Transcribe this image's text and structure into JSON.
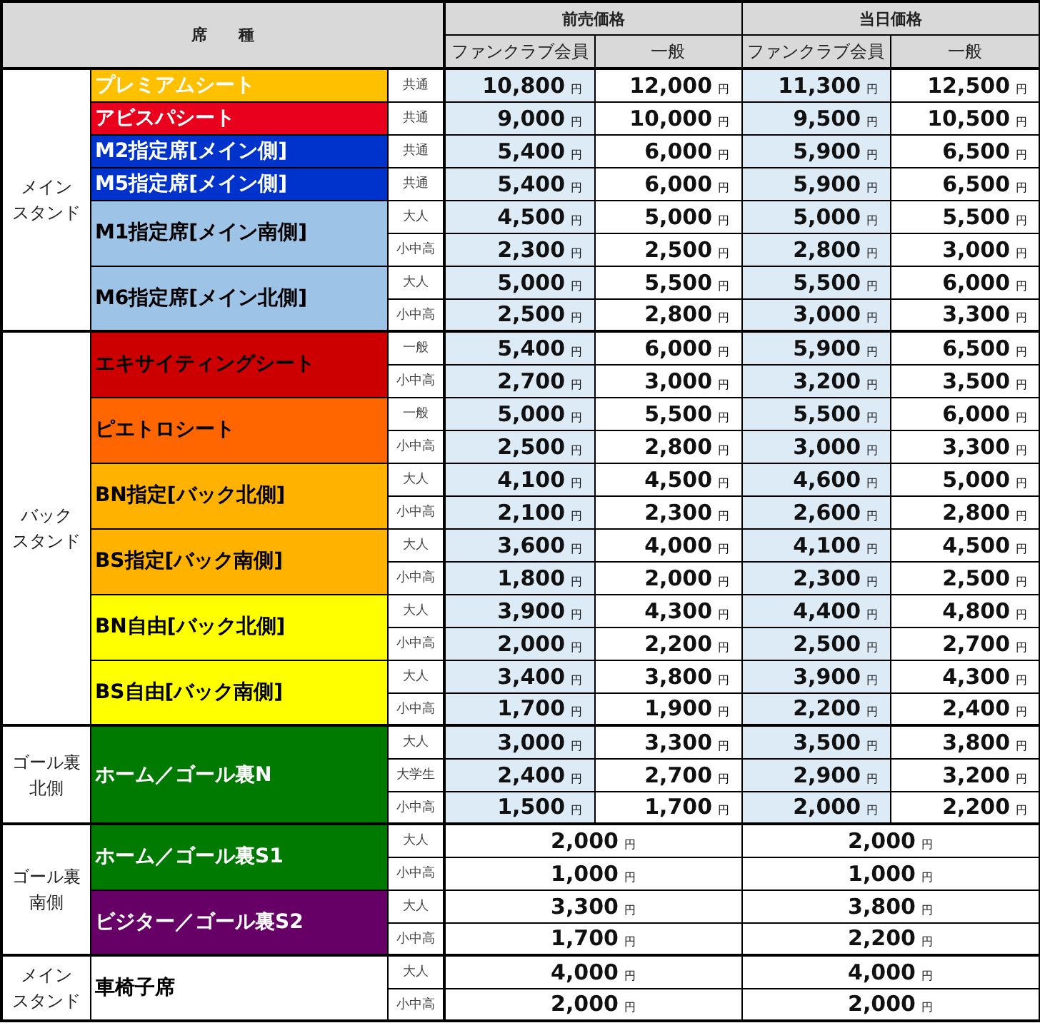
{
  "header": {
    "seat_type": "席　　種",
    "presale": "前売価格",
    "sameday": "当日価格",
    "columns": [
      "ファンクラブ会員",
      "一般",
      "ファンクラブ会員",
      "一般"
    ]
  },
  "groups": [
    {
      "area": [
        "メイン",
        "スタンド"
      ],
      "seats": [
        {
          "name": "プレミアムシート",
          "color": "#ffc000",
          "inverse": true,
          "rows": [
            {
              "kind": "split",
              "category": "共通",
              "prices": [
                {
                  "amount": "10,800",
                  "unit": "円"
                },
                {
                  "amount": "12,000",
                  "unit": "円"
                },
                {
                  "amount": "11,300",
                  "unit": "円"
                },
                {
                  "amount": "12,500",
                  "unit": "円"
                }
              ]
            }
          ]
        },
        {
          "name": "アビスパシート",
          "color": "#e8001c",
          "inverse": true,
          "rows": [
            {
              "kind": "split",
              "category": "共通",
              "prices": [
                {
                  "amount": "9,000",
                  "unit": "円"
                },
                {
                  "amount": "10,000",
                  "unit": "円"
                },
                {
                  "amount": "9,500",
                  "unit": "円"
                },
                {
                  "amount": "10,500",
                  "unit": "円"
                }
              ]
            }
          ]
        },
        {
          "name": "M2指定席[メイン側]",
          "color": "#0033cc",
          "inverse": true,
          "rows": [
            {
              "kind": "split",
              "category": "共通",
              "prices": [
                {
                  "amount": "5,400",
                  "unit": "円"
                },
                {
                  "amount": "6,000",
                  "unit": "円"
                },
                {
                  "amount": "5,900",
                  "unit": "円"
                },
                {
                  "amount": "6,500",
                  "unit": "円"
                }
              ]
            }
          ]
        },
        {
          "name": "M5指定席[メイン側]",
          "color": "#0033cc",
          "inverse": true,
          "rows": [
            {
              "kind": "split",
              "category": "共通",
              "prices": [
                {
                  "amount": "5,400",
                  "unit": "円"
                },
                {
                  "amount": "6,000",
                  "unit": "円"
                },
                {
                  "amount": "5,900",
                  "unit": "円"
                },
                {
                  "amount": "6,500",
                  "unit": "円"
                }
              ]
            }
          ]
        },
        {
          "name": "M1指定席[メイン南側]",
          "color": "#9dc3e6",
          "inverse": false,
          "rows": [
            {
              "kind": "split",
              "category": "大人",
              "prices": [
                {
                  "amount": "4,500",
                  "unit": "円"
                },
                {
                  "amount": "5,000",
                  "unit": "円"
                },
                {
                  "amount": "5,000",
                  "unit": "円"
                },
                {
                  "amount": "5,500",
                  "unit": "円"
                }
              ]
            },
            {
              "kind": "split",
              "category": "小中高",
              "prices": [
                {
                  "amount": "2,300",
                  "unit": "円"
                },
                {
                  "amount": "2,500",
                  "unit": "円"
                },
                {
                  "amount": "2,800",
                  "unit": "円"
                },
                {
                  "amount": "3,000",
                  "unit": "円"
                }
              ]
            }
          ]
        },
        {
          "name": "M6指定席[メイン北側]",
          "color": "#9dc3e6",
          "inverse": false,
          "rows": [
            {
              "kind": "split",
              "category": "大人",
              "prices": [
                {
                  "amount": "5,000",
                  "unit": "円"
                },
                {
                  "amount": "5,500",
                  "unit": "円"
                },
                {
                  "amount": "5,500",
                  "unit": "円"
                },
                {
                  "amount": "6,000",
                  "unit": "円"
                }
              ]
            },
            {
              "kind": "split",
              "category": "小中高",
              "prices": [
                {
                  "amount": "2,500",
                  "unit": "円"
                },
                {
                  "amount": "2,800",
                  "unit": "円"
                },
                {
                  "amount": "3,000",
                  "unit": "円"
                },
                {
                  "amount": "3,300",
                  "unit": "円"
                }
              ]
            }
          ]
        }
      ]
    },
    {
      "area": [
        "バック",
        "スタンド"
      ],
      "seats": [
        {
          "name": "エキサイティングシート",
          "color": "#cc0000",
          "inverse": false,
          "rows": [
            {
              "kind": "split",
              "category": "一般",
              "prices": [
                {
                  "amount": "5,400",
                  "unit": "円"
                },
                {
                  "amount": "6,000",
                  "unit": "円"
                },
                {
                  "amount": "5,900",
                  "unit": "円"
                },
                {
                  "amount": "6,500",
                  "unit": "円"
                }
              ]
            },
            {
              "kind": "split",
              "category": "小中高",
              "prices": [
                {
                  "amount": "2,700",
                  "unit": "円"
                },
                {
                  "amount": "3,000",
                  "unit": "円"
                },
                {
                  "amount": "3,200",
                  "unit": "円"
                },
                {
                  "amount": "3,500",
                  "unit": "円"
                }
              ]
            }
          ]
        },
        {
          "name": "ピエトロシート",
          "color": "#ff6600",
          "inverse": false,
          "rows": [
            {
              "kind": "split",
              "category": "一般",
              "prices": [
                {
                  "amount": "5,000",
                  "unit": "円"
                },
                {
                  "amount": "5,500",
                  "unit": "円"
                },
                {
                  "amount": "5,500",
                  "unit": "円"
                },
                {
                  "amount": "6,000",
                  "unit": "円"
                }
              ]
            },
            {
              "kind": "split",
              "category": "小中高",
              "prices": [
                {
                  "amount": "2,500",
                  "unit": "円"
                },
                {
                  "amount": "2,800",
                  "unit": "円"
                },
                {
                  "amount": "3,000",
                  "unit": "円"
                },
                {
                  "amount": "3,300",
                  "unit": "円"
                }
              ]
            }
          ]
        },
        {
          "name": "BN指定[バック北側]",
          "color": "#ffb300",
          "inverse": false,
          "rows": [
            {
              "kind": "split",
              "category": "大人",
              "prices": [
                {
                  "amount": "4,100",
                  "unit": "円"
                },
                {
                  "amount": "4,500",
                  "unit": "円"
                },
                {
                  "amount": "4,600",
                  "unit": "円"
                },
                {
                  "amount": "5,000",
                  "unit": "円"
                }
              ]
            },
            {
              "kind": "split",
              "category": "小中高",
              "prices": [
                {
                  "amount": "2,100",
                  "unit": "円"
                },
                {
                  "amount": "2,300",
                  "unit": "円"
                },
                {
                  "amount": "2,600",
                  "unit": "円"
                },
                {
                  "amount": "2,800",
                  "unit": "円"
                }
              ]
            }
          ]
        },
        {
          "name": "BS指定[バック南側]",
          "color": "#ffb300",
          "inverse": false,
          "rows": [
            {
              "kind": "split",
              "category": "大人",
              "prices": [
                {
                  "amount": "3,600",
                  "unit": "円"
                },
                {
                  "amount": "4,000",
                  "unit": "円"
                },
                {
                  "amount": "4,100",
                  "unit": "円"
                },
                {
                  "amount": "4,500",
                  "unit": "円"
                }
              ]
            },
            {
              "kind": "split",
              "category": "小中高",
              "prices": [
                {
                  "amount": "1,800",
                  "unit": "円"
                },
                {
                  "amount": "2,000",
                  "unit": "円"
                },
                {
                  "amount": "2,300",
                  "unit": "円"
                },
                {
                  "amount": "2,500",
                  "unit": "円"
                }
              ]
            }
          ]
        },
        {
          "name": "BN自由[バック北側]",
          "color": "#ffff00",
          "inverse": false,
          "rows": [
            {
              "kind": "split",
              "category": "大人",
              "prices": [
                {
                  "amount": "3,900",
                  "unit": "円"
                },
                {
                  "amount": "4,300",
                  "unit": "円"
                },
                {
                  "amount": "4,400",
                  "unit": "円"
                },
                {
                  "amount": "4,800",
                  "unit": "円"
                }
              ]
            },
            {
              "kind": "split",
              "category": "小中高",
              "prices": [
                {
                  "amount": "2,000",
                  "unit": "円"
                },
                {
                  "amount": "2,200",
                  "unit": "円"
                },
                {
                  "amount": "2,500",
                  "unit": "円"
                },
                {
                  "amount": "2,700",
                  "unit": "円"
                }
              ]
            }
          ]
        },
        {
          "name": "BS自由[バック南側]",
          "color": "#ffff00",
          "inverse": false,
          "rows": [
            {
              "kind": "split",
              "category": "大人",
              "prices": [
                {
                  "amount": "3,400",
                  "unit": "円"
                },
                {
                  "amount": "3,800",
                  "unit": "円"
                },
                {
                  "amount": "3,900",
                  "unit": "円"
                },
                {
                  "amount": "4,300",
                  "unit": "円"
                }
              ]
            },
            {
              "kind": "split",
              "category": "小中高",
              "prices": [
                {
                  "amount": "1,700",
                  "unit": "円"
                },
                {
                  "amount": "1,900",
                  "unit": "円"
                },
                {
                  "amount": "2,200",
                  "unit": "円"
                },
                {
                  "amount": "2,400",
                  "unit": "円"
                }
              ]
            }
          ]
        }
      ]
    },
    {
      "area": [
        "ゴール裏",
        "北側"
      ],
      "seats": [
        {
          "name": "ホーム／ゴール裏N",
          "color": "#007a00",
          "inverse": true,
          "rows": [
            {
              "kind": "split",
              "category": "大人",
              "prices": [
                {
                  "amount": "3,000",
                  "unit": "円"
                },
                {
                  "amount": "3,300",
                  "unit": "円"
                },
                {
                  "amount": "3,500",
                  "unit": "円"
                },
                {
                  "amount": "3,800",
                  "unit": "円"
                }
              ]
            },
            {
              "kind": "split",
              "category": "大学生",
              "prices": [
                {
                  "amount": "2,400",
                  "unit": "円"
                },
                {
                  "amount": "2,700",
                  "unit": "円"
                },
                {
                  "amount": "2,900",
                  "unit": "円"
                },
                {
                  "amount": "3,200",
                  "unit": "円"
                }
              ]
            },
            {
              "kind": "split",
              "category": "小中高",
              "prices": [
                {
                  "amount": "1,500",
                  "unit": "円"
                },
                {
                  "amount": "1,700",
                  "unit": "円"
                },
                {
                  "amount": "2,000",
                  "unit": "円"
                },
                {
                  "amount": "2,200",
                  "unit": "円"
                }
              ]
            }
          ]
        }
      ]
    },
    {
      "area": [
        "ゴール裏",
        "南側"
      ],
      "seats": [
        {
          "name": "ホーム／ゴール裏S1",
          "color": "#007a00",
          "inverse": true,
          "rows": [
            {
              "kind": "merged",
              "category": "大人",
              "prices": [
                {
                  "amount": "2,000",
                  "unit": "円"
                },
                {
                  "amount": "2,000",
                  "unit": "円"
                }
              ]
            },
            {
              "kind": "merged",
              "category": "小中高",
              "prices": [
                {
                  "amount": "1,000",
                  "unit": "円"
                },
                {
                  "amount": "1,000",
                  "unit": "円"
                }
              ]
            }
          ]
        },
        {
          "name": "ビジター／ゴール裏S2",
          "color": "#660066",
          "inverse": true,
          "rows": [
            {
              "kind": "merged",
              "category": "大人",
              "prices": [
                {
                  "amount": "3,300",
                  "unit": "円"
                },
                {
                  "amount": "3,800",
                  "unit": "円"
                }
              ]
            },
            {
              "kind": "merged",
              "category": "小中高",
              "prices": [
                {
                  "amount": "1,700",
                  "unit": "円"
                },
                {
                  "amount": "2,200",
                  "unit": "円"
                }
              ]
            }
          ]
        }
      ]
    },
    {
      "area": [
        "メイン",
        "スタンド"
      ],
      "seats": [
        {
          "name": "車椅子席",
          "color": "#ffffff",
          "inverse": false,
          "rows": [
            {
              "kind": "merged",
              "category": "大人",
              "prices": [
                {
                  "amount": "4,000",
                  "unit": "円"
                },
                {
                  "amount": "4,000",
                  "unit": "円"
                }
              ]
            },
            {
              "kind": "merged",
              "category": "小中高",
              "prices": [
                {
                  "amount": "2,000",
                  "unit": "円"
                },
                {
                  "amount": "2,000",
                  "unit": "円"
                }
              ]
            }
          ]
        }
      ]
    }
  ]
}
